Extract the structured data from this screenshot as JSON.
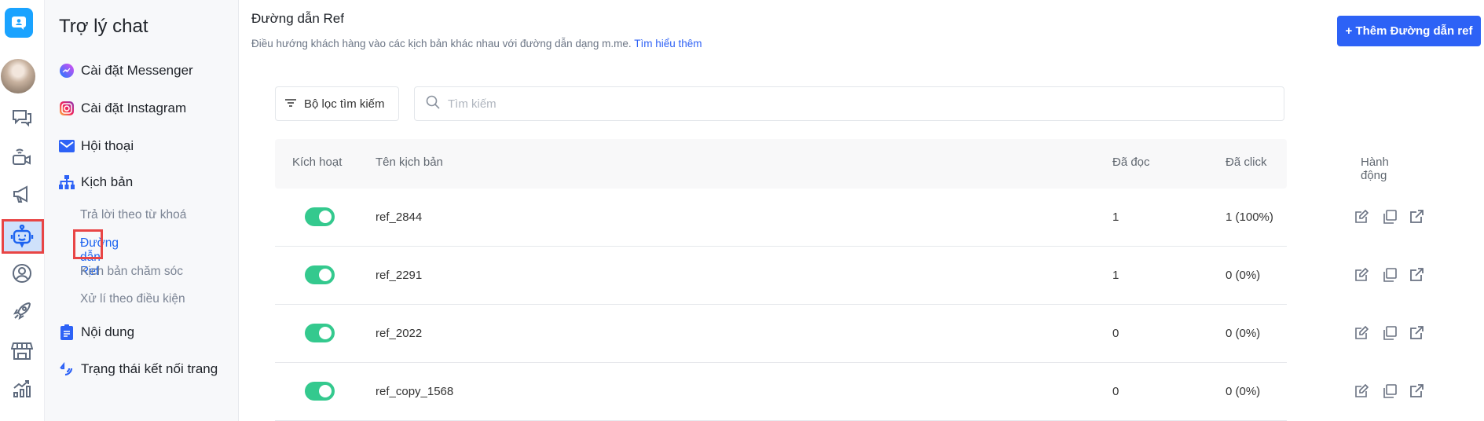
{
  "rail": {
    "items": [
      "chat-icon",
      "livestream-icon",
      "megaphone-icon",
      "robot-icon",
      "user-icon",
      "rocket-icon",
      "store-icon",
      "chart-icon"
    ]
  },
  "sidebar": {
    "title": "Trợ lý chat",
    "items": [
      {
        "label": "Cài đặt Messenger"
      },
      {
        "label": "Cài đặt Instagram"
      },
      {
        "label": "Hội thoại"
      },
      {
        "label": "Kịch bản"
      },
      {
        "label": "Nội dung"
      },
      {
        "label": "Trạng thái kết nối trang"
      }
    ],
    "subitems": [
      {
        "label": "Trả lời theo từ khoá"
      },
      {
        "label": "Đường dẫn Ref"
      },
      {
        "label": "Kịch bản chăm sóc"
      },
      {
        "label": "Xử lí theo điều kiện"
      }
    ]
  },
  "header": {
    "title": "Đường dẫn Ref",
    "description": "Điều hướng khách hàng vào các kịch bản khác nhau với đường dẫn dạng m.me.",
    "learn_more": "Tìm hiểu thêm",
    "add_button": "+ Thêm Đường dẫn ref"
  },
  "filter": {
    "label": "Bộ lọc tìm kiếm",
    "search_placeholder": "Tìm kiếm"
  },
  "table": {
    "columns": [
      "Kích hoạt",
      "Tên kịch bản",
      "Đã đọc",
      "Đã click",
      "Hành động"
    ],
    "rows": [
      {
        "active": true,
        "name": "ref_2844",
        "read": "1",
        "click": "1 (100%)"
      },
      {
        "active": true,
        "name": "ref_2291",
        "read": "1",
        "click": "0 (0%)"
      },
      {
        "active": true,
        "name": "ref_2022",
        "read": "0",
        "click": "0 (0%)"
      },
      {
        "active": true,
        "name": "ref_copy_1568",
        "read": "0",
        "click": "0 (0%)"
      }
    ]
  },
  "colors": {
    "primary": "#2d62f6",
    "toggle": "#34c98e",
    "highlight": "#e84545"
  }
}
